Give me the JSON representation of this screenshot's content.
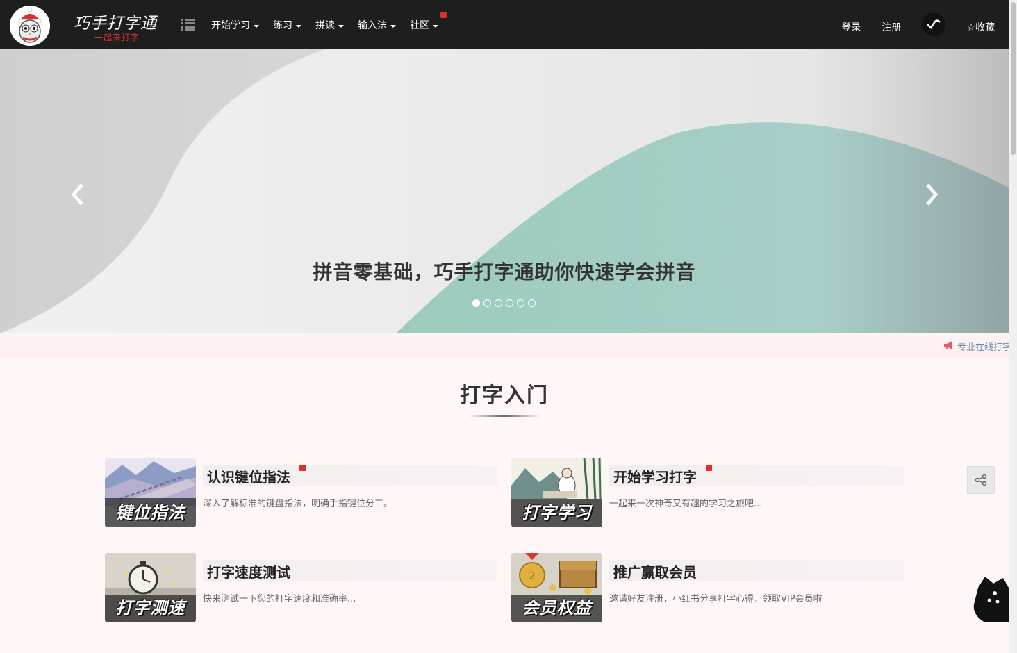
{
  "brand": {
    "name": "巧手打字通",
    "subtitle": "——一起来打字——"
  },
  "nav": {
    "menu_icon": "list-icon",
    "items": [
      {
        "label": "开始学习",
        "dropdown": true
      },
      {
        "label": "练习",
        "dropdown": true
      },
      {
        "label": "拼读",
        "dropdown": true
      },
      {
        "label": "输入法",
        "dropdown": true
      },
      {
        "label": "社区",
        "dropdown": true,
        "hot": true
      }
    ],
    "login": "登录",
    "register": "注册",
    "favorite": "☆收藏"
  },
  "carousel": {
    "caption": "拼音零基础，巧手打字通助你快速学会拼音",
    "slide_count": 6,
    "active_index": 0
  },
  "marquee": {
    "text": "专业在线打字"
  },
  "section": {
    "title": "打字入门",
    "cards": [
      {
        "thumb_label": "键位指法",
        "title": "认识键位指法",
        "hot": true,
        "desc": "深入了解标准的键盘指法，明确手指键位分工。"
      },
      {
        "thumb_label": "打字学习",
        "title": "开始学习打字",
        "hot": true,
        "desc": "一起来一次神奇又有趣的学习之旅吧..."
      },
      {
        "thumb_label": "打字测速",
        "title": "打字速度测试",
        "hot": false,
        "desc": "快来测试一下您的打字速度和准确率..."
      },
      {
        "thumb_label": "会员权益",
        "title": "推广赢取会员",
        "hot": false,
        "desc": "邀请好友注册，小红书分享打字心得，领取VIP会员啦"
      }
    ]
  },
  "colors": {
    "navbar": "#1e1e1e",
    "accent_red": "#e0302a",
    "teal_wave": "#9ccbbe",
    "section_bg": "#fff6f8"
  }
}
